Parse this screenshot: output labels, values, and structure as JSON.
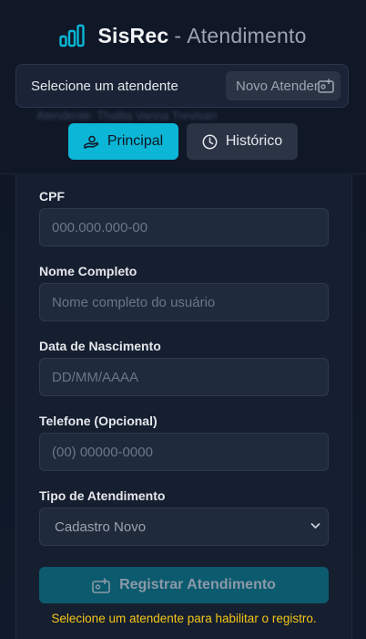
{
  "header": {
    "brand_name": "SisRec",
    "brand_separator": "-",
    "brand_subtitle": "Atendimento",
    "select_label": "Selecione um atendente",
    "new_button_label": "Novo Atendente",
    "blurred_text": "Atendente: Thalita Vanna Trevisan"
  },
  "tabs": [
    {
      "label": "Principal",
      "icon": "hand-money-icon",
      "active": true
    },
    {
      "label": "Histórico",
      "icon": "clock-icon",
      "active": false
    }
  ],
  "form": {
    "cpf": {
      "label": "CPF",
      "placeholder": "000.000.000-00"
    },
    "name": {
      "label": "Nome Completo",
      "placeholder": "Nome completo do usuário"
    },
    "birth": {
      "label": "Data de Nascimento",
      "placeholder": "DD/MM/AAAA"
    },
    "phone": {
      "label": "Telefone (Opcional)",
      "placeholder": "(00) 00000-0000"
    },
    "type": {
      "label": "Tipo de Atendimento",
      "selected": "Cadastro Novo"
    },
    "submit_label": "Registrar Atendimento",
    "warning": "Selecione um atendente para habilitar o registro."
  },
  "colors": {
    "accent": "#0bb6d6",
    "warning": "#f5c518",
    "background": "#0f1726"
  }
}
